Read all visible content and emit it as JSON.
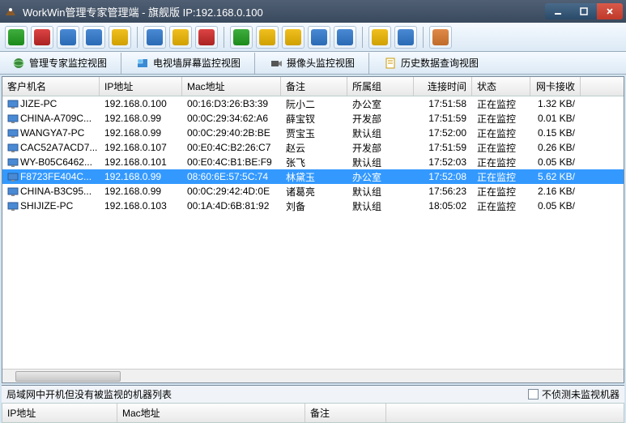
{
  "title": "WorkWin管理专家管理端 - 旗舰版 IP:192.168.0.100",
  "tabs": {
    "t1": "管理专家监控视图",
    "t2": "电视墙屏幕监控视图",
    "t3": "摄像头监控视图",
    "t4": "历史数据查询视图"
  },
  "columns": {
    "c0": "客户机名",
    "c1": "IP地址",
    "c2": "Mac地址",
    "c3": "备注",
    "c4": "所属组",
    "c5": "连接时间",
    "c6": "状态",
    "c7": "网卡接收"
  },
  "rows": [
    {
      "name": "JIZE-PC",
      "ip": "192.168.0.100",
      "mac": "00:16:D3:26:B3:39",
      "remark": "阮小二",
      "group": "办公室",
      "time": "17:51:58",
      "status": "正在监控",
      "net": "1.32 KB/"
    },
    {
      "name": "CHINA-A709C...",
      "ip": "192.168.0.99",
      "mac": "00:0C:29:34:62:A6",
      "remark": "薛宝钗",
      "group": "开发部",
      "time": "17:51:59",
      "status": "正在监控",
      "net": "0.01 KB/"
    },
    {
      "name": "WANGYA7-PC",
      "ip": "192.168.0.99",
      "mac": "00:0C:29:40:2B:BE",
      "remark": "贾宝玉",
      "group": "默认组",
      "time": "17:52:00",
      "status": "正在监控",
      "net": "0.15 KB/"
    },
    {
      "name": "CAC52A7ACD7...",
      "ip": "192.168.0.107",
      "mac": "00:E0:4C:B2:26:C7",
      "remark": "赵云",
      "group": "开发部",
      "time": "17:51:59",
      "status": "正在监控",
      "net": "0.26 KB/"
    },
    {
      "name": "WY-B05C6462...",
      "ip": "192.168.0.101",
      "mac": "00:E0:4C:B1:BE:F9",
      "remark": "张飞",
      "group": "默认组",
      "time": "17:52:03",
      "status": "正在监控",
      "net": "0.05 KB/"
    },
    {
      "name": "F8723FE404C...",
      "ip": "192.168.0.99",
      "mac": "08:60:6E:57:5C:74",
      "remark": "林黛玉",
      "group": "办公室",
      "time": "17:52:08",
      "status": "正在监控",
      "net": "5.62 KB/",
      "selected": true
    },
    {
      "name": "CHINA-B3C95...",
      "ip": "192.168.0.99",
      "mac": "00:0C:29:42:4D:0E",
      "remark": "诸葛亮",
      "group": "默认组",
      "time": "17:56:23",
      "status": "正在监控",
      "net": "2.16 KB/"
    },
    {
      "name": "SHIJIZE-PC",
      "ip": "192.168.0.103",
      "mac": "00:1A:4D:6B:81:92",
      "remark": "刘备",
      "group": "默认组",
      "time": "18:05:02",
      "status": "正在监控",
      "net": "0.05 KB/"
    }
  ],
  "bottom": {
    "title": "局域网中开机但没有被监视的机器列表",
    "checkbox": "不侦测未监视机器",
    "c0": "IP地址",
    "c1": "Mac地址",
    "c2": "备注"
  }
}
